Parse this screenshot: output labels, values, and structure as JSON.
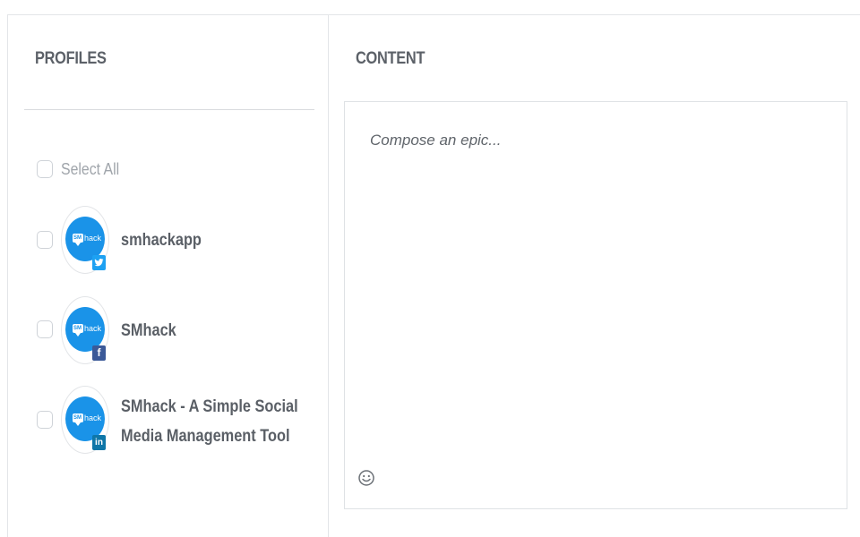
{
  "profiles": {
    "title": "PROFILES",
    "select_all_label": "Select All",
    "items": [
      {
        "name": "smhackapp",
        "network": "twitter",
        "network_icon": "twitter-icon",
        "badge_glyph": "🐦",
        "logo_mark": "SM",
        "logo_text": "hack"
      },
      {
        "name": "SMhack",
        "network": "facebook",
        "network_icon": "facebook-icon",
        "badge_glyph": "f",
        "logo_mark": "SM",
        "logo_text": "hack"
      },
      {
        "name": "SMhack - A Simple Social Media Management Tool",
        "network": "linkedin",
        "network_icon": "linkedin-icon",
        "badge_glyph": "in",
        "logo_mark": "SM",
        "logo_text": "hack"
      }
    ]
  },
  "content": {
    "title": "CONTENT",
    "compose_placeholder": "Compose an epic...",
    "compose_value": "",
    "emoji_icon": "smiley-icon"
  },
  "colors": {
    "brand_blue": "#1a93e8",
    "twitter": "#1da1f2",
    "facebook": "#3b5998",
    "linkedin": "#0e76a8",
    "border": "#e3e5e8",
    "heading_text": "#5c6168"
  }
}
